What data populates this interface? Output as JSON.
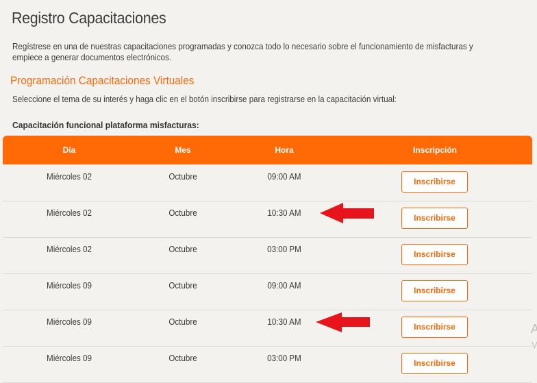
{
  "page": {
    "title": "Registro Capacitaciones",
    "intro": "Regístrese en una de nuestras capacitaciones programadas y conozca todo lo necesario sobre el funcionamiento de misfacturas y empiece a generar documentos electrónicos.",
    "section_title": "Programación Capacitaciones Virtuales",
    "instructions": "Seleccione el tema de su interés y haga clic en el botón inscribirse para registrarse en la capacitación virtual:",
    "table_caption": "Capacitación funcional plataforma misfacturas:"
  },
  "table": {
    "headers": [
      "Día",
      "Mes",
      "Hora",
      "Inscripción"
    ],
    "rows": [
      {
        "dia": "Miércoles 02",
        "mes": "Octubre",
        "hora": "09:00 AM",
        "action": "Inscribirse"
      },
      {
        "dia": "Miércoles 02",
        "mes": "Octubre",
        "hora": "10:30 AM",
        "action": "Inscribirse"
      },
      {
        "dia": "Miércoles 02",
        "mes": "Octubre",
        "hora": "03:00 PM",
        "action": "Inscribirse"
      },
      {
        "dia": "Miércoles 09",
        "mes": "Octubre",
        "hora": "09:00 AM",
        "action": "Inscribirse"
      },
      {
        "dia": "Miércoles 09",
        "mes": "Octubre",
        "hora": "10:30 AM",
        "action": "Inscribirse"
      },
      {
        "dia": "Miércoles 09",
        "mes": "Octubre",
        "hora": "03:00 PM",
        "action": "Inscribirse"
      }
    ]
  },
  "edge_text": {
    "line1": "A",
    "line2": "V"
  },
  "colors": {
    "accent": "#f26b10",
    "header_bg": "#ff6a06",
    "arrow": "#e8141c",
    "background": "#f3f2ee"
  },
  "icons": [
    "arrow-left-icon"
  ]
}
